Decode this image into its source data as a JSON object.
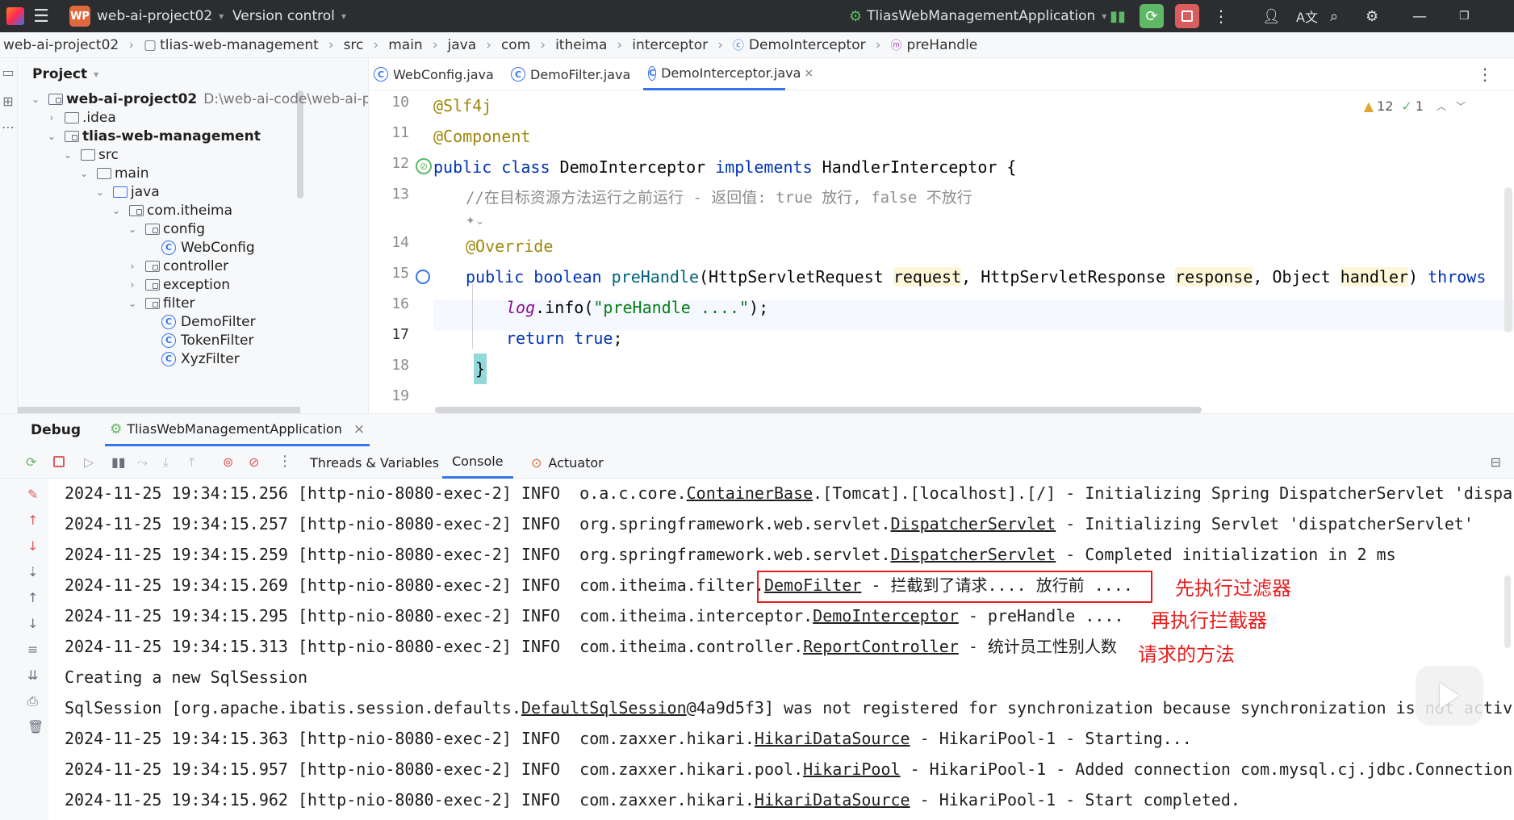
{
  "titlebar": {
    "project_badge": "WP",
    "project_name": "web-ai-project02",
    "vcs": "Version control",
    "run_config": "TliasWebManagementApplication"
  },
  "breadcrumb": [
    "web-ai-project02",
    "tlias-web-management",
    "src",
    "main",
    "java",
    "com",
    "itheima",
    "interceptor",
    "DemoInterceptor",
    "preHandle"
  ],
  "project": {
    "header": "Project",
    "root_name": "web-ai-project02",
    "root_path": "D:\\web-ai-code\\web-ai-proj",
    "items": [
      {
        "label": ".idea"
      },
      {
        "label": "tlias-web-management"
      },
      {
        "label": "src"
      },
      {
        "label": "main"
      },
      {
        "label": "java"
      },
      {
        "label": "com.itheima"
      },
      {
        "label": "config"
      },
      {
        "label": "WebConfig"
      },
      {
        "label": "controller"
      },
      {
        "label": "exception"
      },
      {
        "label": "filter"
      },
      {
        "label": "DemoFilter"
      },
      {
        "label": "TokenFilter"
      },
      {
        "label": "XyzFilter"
      }
    ]
  },
  "editor_tabs": [
    {
      "label": "WebConfig.java"
    },
    {
      "label": "DemoFilter.java"
    },
    {
      "label": "DemoInterceptor.java"
    }
  ],
  "inspections": {
    "warnings": "12",
    "ok": "1"
  },
  "code": {
    "line_numbers": [
      "10",
      "11",
      "12",
      "13",
      "14",
      "15",
      "16",
      "17",
      "18",
      "19"
    ],
    "l10": "@Slf4j",
    "l11": "@Component",
    "l12_kw1": "public class ",
    "l12_name": "DemoInterceptor ",
    "l12_kw2": "implements ",
    "l12_rest": "HandlerInterceptor {",
    "l13": "//在目标资源方法运行之前运行 - 返回值: true 放行, false 不放行",
    "l14": "@Override",
    "l15_kw": "public boolean ",
    "l15_fn": "preHandle",
    "l15_a": "(HttpServletRequest ",
    "l15_p1": "request",
    "l15_b": ", HttpServletResponse ",
    "l15_p2": "response",
    "l15_c": ", Object ",
    "l15_p3": "handler",
    "l15_d": ") ",
    "l15_kw2": "throws",
    "l16_log": "log",
    "l16_a": ".info(",
    "l16_str": "\"preHandle ....\"",
    "l16_b": ");",
    "l17_kw": "return true",
    "l17_b": ";",
    "l18": "}"
  },
  "debug": {
    "title": "Debug",
    "session": "TliasWebManagementApplication",
    "tabs": [
      "Threads & Variables",
      "Console",
      "Actuator"
    ]
  },
  "console": {
    "lines": [
      {
        "pre": "2024-11-25 19:34:15.256 [http-nio-8080-exec-2] INFO  o.a.c.core.",
        "u": "ContainerBase",
        "post": ".[Tomcat].[localhost].[/] - Initializing Spring DispatcherServlet 'dispa"
      },
      {
        "pre": "2024-11-25 19:34:15.257 [http-nio-8080-exec-2] INFO  org.springframework.web.servlet.",
        "u": "DispatcherServlet",
        "post": " - Initializing Servlet 'dispatcherServlet'"
      },
      {
        "pre": "2024-11-25 19:34:15.259 [http-nio-8080-exec-2] INFO  org.springframework.web.servlet.",
        "u": "DispatcherServlet",
        "post": " - Completed initialization in 2 ms"
      },
      {
        "pre": "2024-11-25 19:34:15.269 [http-nio-8080-exec-2] INFO  com.itheima.filter.",
        "u": "DemoFilter",
        "post": " - 拦截到了请求.... 放行前 ...."
      },
      {
        "pre": "2024-11-25 19:34:15.295 [http-nio-8080-exec-2] INFO  com.itheima.interceptor.",
        "u": "DemoInterceptor",
        "post": " - preHandle ...."
      },
      {
        "pre": "2024-11-25 19:34:15.313 [http-nio-8080-exec-2] INFO  com.itheima.controller.",
        "u": "ReportController",
        "post": " - 统计员工性别人数"
      },
      {
        "pre": "Creating a new SqlSession",
        "u": "",
        "post": ""
      },
      {
        "pre": "SqlSession [org.apache.ibatis.session.defaults.",
        "u": "DefaultSqlSession",
        "post": "@4a9d5f3] was not registered for synchronization because synchronization is not activ"
      },
      {
        "pre": "2024-11-25 19:34:15.363 [http-nio-8080-exec-2] INFO  com.zaxxer.hikari.",
        "u": "HikariDataSource",
        "post": " - HikariPool-1 - Starting..."
      },
      {
        "pre": "2024-11-25 19:34:15.957 [http-nio-8080-exec-2] INFO  com.zaxxer.hikari.pool.",
        "u": "HikariPool",
        "post": " - HikariPool-1 - Added connection com.mysql.cj.jdbc.Connection"
      },
      {
        "pre": "2024-11-25 19:34:15.962 [http-nio-8080-exec-2] INFO  com.zaxxer.hikari.",
        "u": "HikariDataSource",
        "post": " - HikariPool-1 - Start completed."
      }
    ]
  },
  "annotations": {
    "filter_note": "先执行过滤器",
    "interceptor_note": "再执行拦截器",
    "method_note": "请求的方法"
  },
  "colors": {
    "accent": "#3574f0",
    "annotation_red": "#e61e1e",
    "titlebar": "#2b2d30"
  }
}
